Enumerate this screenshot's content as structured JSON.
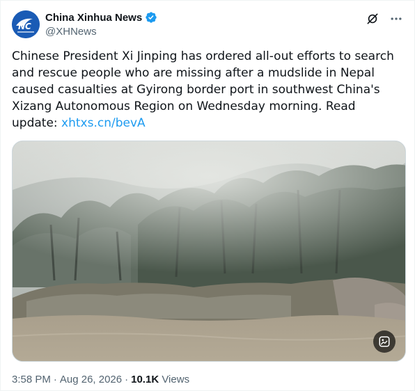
{
  "author": {
    "display_name": "China Xinhua News",
    "handle": "@XHNews",
    "avatar_icon": "xinhua-logo-icon",
    "verified_icon": "verified-badge-icon",
    "verified_color": "#1d9bf0"
  },
  "tweet": {
    "text_before_link": "Chinese President Xi Jinping has ordered all-out efforts to search and rescue people who are missing after a mudslide in Nepal caused casualties at Gyirong border port in southwest China's Xizang Autonomous Region on Wednesday morning. Read update: ",
    "link_text": "xhtxs.cn/bevA",
    "link_color": "#1d9bf0"
  },
  "media": {
    "alt_button_icon": "image-edit-icon"
  },
  "meta": {
    "time": "3:58 PM",
    "separator": "·",
    "date": "Aug 26, 2026",
    "views_count": "10.1K",
    "views_label": "Views"
  },
  "actions": {
    "grok_icon": "grok-icon",
    "more_icon": "more-icon"
  }
}
